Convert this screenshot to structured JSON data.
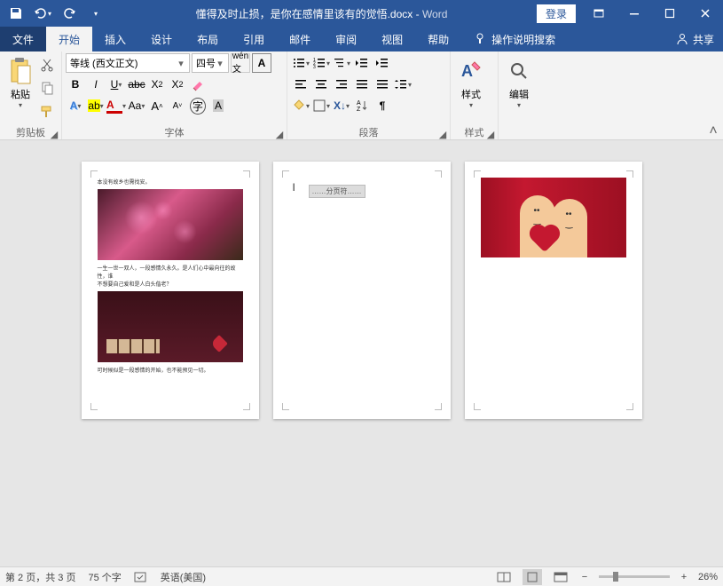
{
  "title": {
    "document": "懂得及时止损，是你在感情里该有的觉悟.docx",
    "separator": " - ",
    "app": "Word",
    "login": "登录"
  },
  "tabs": {
    "file": "文件",
    "home": "开始",
    "insert": "插入",
    "design": "设计",
    "layout": "布局",
    "references": "引用",
    "mailings": "邮件",
    "review": "审阅",
    "view": "视图",
    "help": "帮助",
    "tellme": "操作说明搜索",
    "share": "共享"
  },
  "ribbon": {
    "clipboard": {
      "label": "剪贴板",
      "paste": "粘贴"
    },
    "font": {
      "label": "字体",
      "family": "等线 (西文正文)",
      "size": "四号"
    },
    "paragraph": {
      "label": "段落"
    },
    "styles": {
      "label": "样式",
      "button": "样式"
    },
    "editing": {
      "label": "",
      "button": "编辑"
    }
  },
  "pages": {
    "p1": {
      "line1": "本没有故乡也需找安。",
      "line2": "一生一世一双人，一段感情久永久。是人们心中最向往的故性，谁",
      "line3": "不想要自己爱和是人白头偕老？",
      "line4": "可时候似是一段感情的开始，也不能预见一切。"
    },
    "p2": {
      "pagebreak": "……分页符……"
    }
  },
  "status": {
    "page": "第 2 页，共 3 页",
    "words": "75 个字",
    "lang": "英语(美国)",
    "zoom": "26%"
  }
}
